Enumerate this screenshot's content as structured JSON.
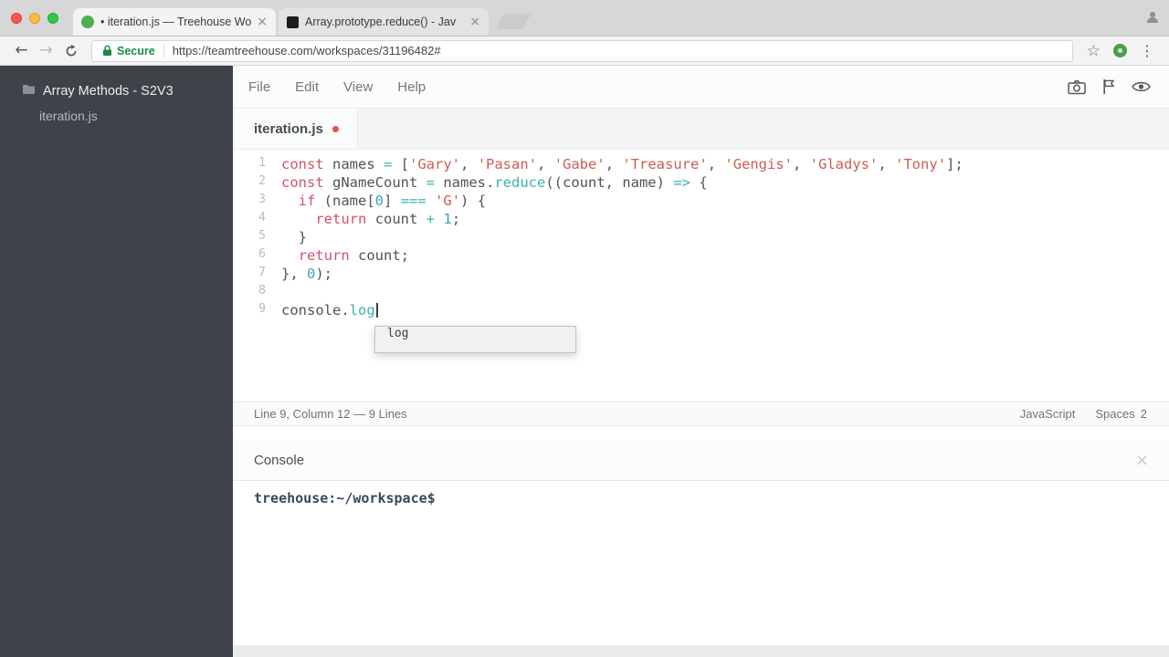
{
  "browser": {
    "tabs": [
      {
        "title": "• iteration.js — Treehouse Wo",
        "favicon": "treehouse-icon",
        "active": true
      },
      {
        "title": "Array.prototype.reduce() - Jav",
        "favicon": "mdn-icon",
        "active": false
      }
    ],
    "toolbar": {
      "secure_label": "Secure",
      "url": "https://teamtreehouse.com/workspaces/31196482#"
    }
  },
  "icons": {
    "back": "←",
    "forward": "→",
    "bookmark_star": "☆",
    "menu_dots": "⋮",
    "close": "×"
  },
  "workspace": {
    "sidebar": {
      "project_name": "Array Methods - S2V3",
      "files": [
        "iteration.js"
      ]
    },
    "menu": {
      "items": [
        "File",
        "Edit",
        "View",
        "Help"
      ]
    },
    "editor": {
      "tab_name": "iteration.js",
      "modified": true,
      "autocomplete_items": [
        "log"
      ],
      "status_left": "Line 9, Column 12 — 9 Lines",
      "status_language": "JavaScript",
      "status_indent_label": "Spaces",
      "status_indent_value": "2"
    },
    "console": {
      "title": "Console",
      "prompt": "treehouse:~/workspace$"
    }
  },
  "code": {
    "lines": [
      {
        "num": 1,
        "tokens": [
          {
            "t": "const",
            "c": "kw"
          },
          {
            "t": " names ",
            "c": "pl"
          },
          {
            "t": "=",
            "c": "op"
          },
          {
            "t": " [",
            "c": "pl"
          },
          {
            "t": "'Gary'",
            "c": "str"
          },
          {
            "t": ", ",
            "c": "pl"
          },
          {
            "t": "'Pasan'",
            "c": "str"
          },
          {
            "t": ", ",
            "c": "pl"
          },
          {
            "t": "'Gabe'",
            "c": "str"
          },
          {
            "t": ", ",
            "c": "pl"
          },
          {
            "t": "'Treasure'",
            "c": "str"
          },
          {
            "t": ", ",
            "c": "pl"
          },
          {
            "t": "'Gengis'",
            "c": "str"
          },
          {
            "t": ", ",
            "c": "pl"
          },
          {
            "t": "'Gladys'",
            "c": "str"
          },
          {
            "t": ", ",
            "c": "pl"
          },
          {
            "t": "'Tony'",
            "c": "str"
          },
          {
            "t": "];",
            "c": "pl"
          }
        ]
      },
      {
        "num": 2,
        "tokens": [
          {
            "t": "const",
            "c": "kw"
          },
          {
            "t": " gNameCount ",
            "c": "pl"
          },
          {
            "t": "=",
            "c": "op"
          },
          {
            "t": " names.",
            "c": "pl"
          },
          {
            "t": "reduce",
            "c": "fn"
          },
          {
            "t": "((count, name) ",
            "c": "pl"
          },
          {
            "t": "=>",
            "c": "op"
          },
          {
            "t": " {",
            "c": "pl"
          }
        ]
      },
      {
        "num": 3,
        "tokens": [
          {
            "t": "  ",
            "c": "pl"
          },
          {
            "t": "if",
            "c": "kw"
          },
          {
            "t": " (name[",
            "c": "pl"
          },
          {
            "t": "0",
            "c": "num"
          },
          {
            "t": "] ",
            "c": "pl"
          },
          {
            "t": "===",
            "c": "op"
          },
          {
            "t": " ",
            "c": "pl"
          },
          {
            "t": "'G'",
            "c": "str"
          },
          {
            "t": ") {",
            "c": "pl"
          }
        ]
      },
      {
        "num": 4,
        "tokens": [
          {
            "t": "    ",
            "c": "pl"
          },
          {
            "t": "return",
            "c": "kw"
          },
          {
            "t": " count ",
            "c": "pl"
          },
          {
            "t": "+",
            "c": "op"
          },
          {
            "t": " ",
            "c": "pl"
          },
          {
            "t": "1",
            "c": "num"
          },
          {
            "t": ";",
            "c": "pl"
          }
        ]
      },
      {
        "num": 5,
        "tokens": [
          {
            "t": "  }",
            "c": "pl"
          }
        ]
      },
      {
        "num": 6,
        "tokens": [
          {
            "t": "  ",
            "c": "pl"
          },
          {
            "t": "return",
            "c": "kw"
          },
          {
            "t": " count;",
            "c": "pl"
          }
        ]
      },
      {
        "num": 7,
        "tokens": [
          {
            "t": "}, ",
            "c": "pl"
          },
          {
            "t": "0",
            "c": "num"
          },
          {
            "t": ");",
            "c": "pl"
          }
        ]
      },
      {
        "num": 8,
        "tokens": []
      },
      {
        "num": 9,
        "cursor": true,
        "tokens": [
          {
            "t": "console.",
            "c": "pl"
          },
          {
            "t": "log",
            "c": "fn"
          }
        ]
      }
    ]
  },
  "colors": {
    "syntax": {
      "kw": "#d0536a",
      "str": "#d15b54",
      "op": "#35b5aa",
      "fn": "#35b5aa",
      "num": "#3b9fc6",
      "pl": "#4e5459"
    },
    "sidebar_bg": "#3d4349",
    "secure_green": "#1d8a44",
    "modified_dot": "#e8514d",
    "prompt_color": "#36495f"
  }
}
